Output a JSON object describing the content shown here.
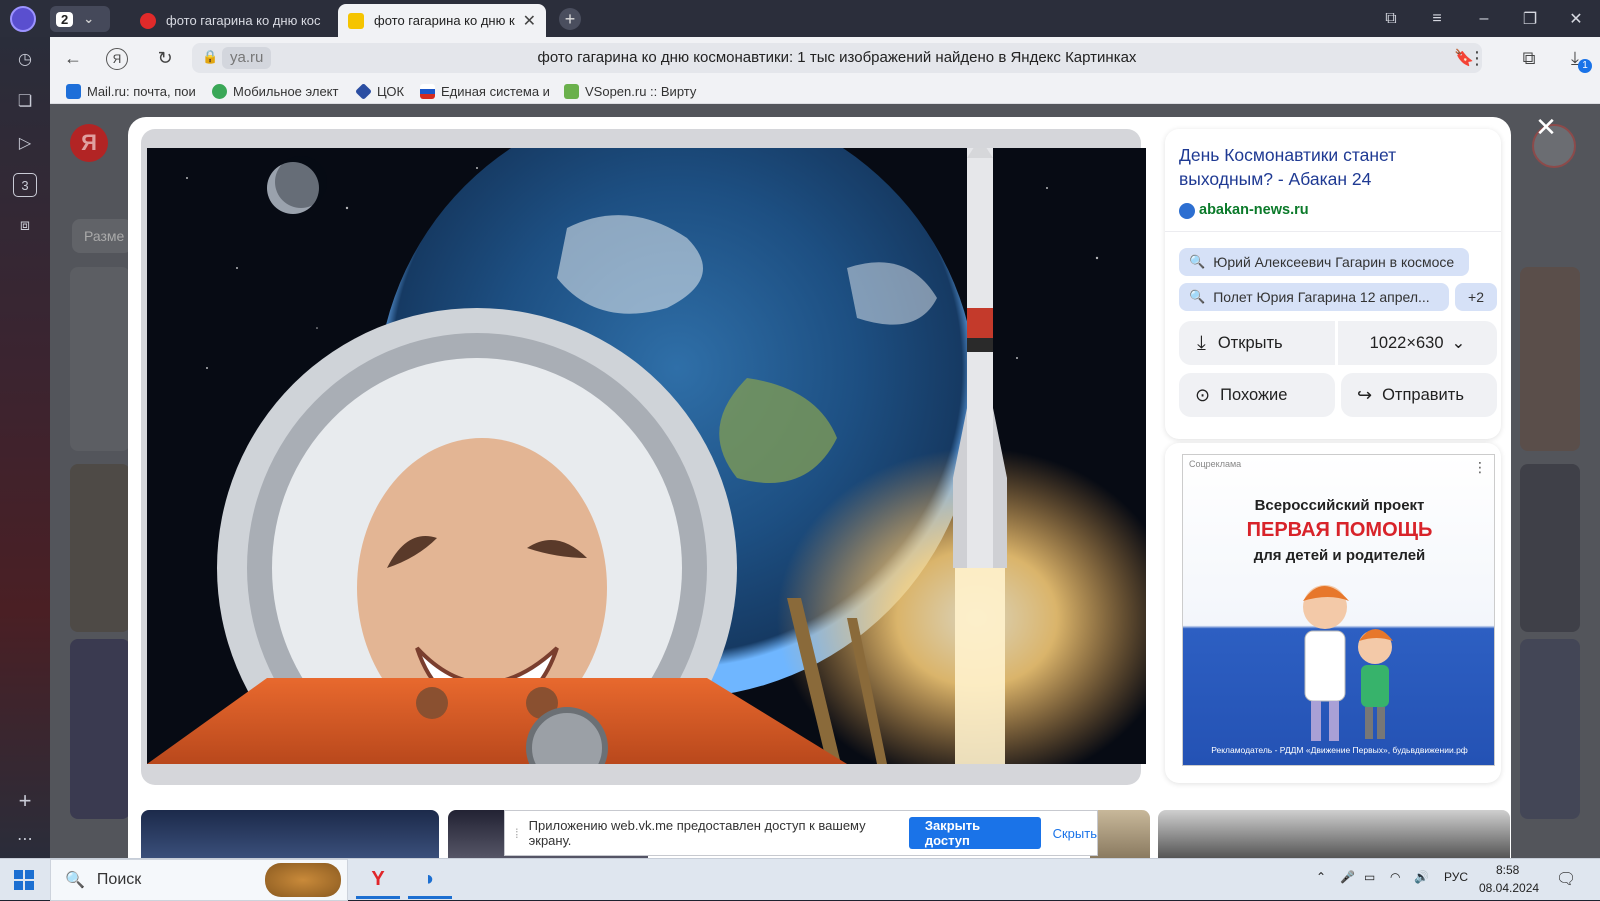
{
  "browser": {
    "tab_count": "2",
    "tabs": [
      {
        "title": "фото гагарина ко дню кос",
        "active": false
      },
      {
        "title": "фото гагарина ко дню к",
        "active": true
      }
    ],
    "url": "ya.ru",
    "page_title": "фото гагарина ко дню космонавтики: 1 тыс изображений найдено в Яндекс Картинках",
    "download_badge": "1"
  },
  "bookmarks": [
    {
      "label": "Mail.ru: почта, пои",
      "color": "#1e6fd9"
    },
    {
      "label": "Мобильное элект",
      "color": "#3aa757"
    },
    {
      "label": "ЦОК",
      "color": "#2b4ea2"
    },
    {
      "label": "Единая система и",
      "color": "#d52b1e"
    },
    {
      "label": "VSopen.ru :: Вирту",
      "color": "#6ab04c"
    }
  ],
  "sidebar": {
    "badge_3": "3"
  },
  "page": {
    "logo": "Я",
    "filter_label": "Разме"
  },
  "viewer": {
    "source_title": "День Космонавтики станет выходным? - Абакан 24",
    "source_domain": "abakan-news.ru",
    "tags": [
      "Юрий Алексеевич Гагарин в космосе",
      "Полет Юрия Гагарина 12 апрел..."
    ],
    "tags_more": "+2",
    "open_label": "Открыть",
    "size_label": "1022×630",
    "similar_label": "Похожие",
    "share_label": "Отправить",
    "ad": {
      "tag": "Соцреклама",
      "line1": "Всероссийский проект",
      "line2": "ПЕРВАЯ ПОМОЩЬ",
      "line3": "для детей и родителей",
      "footer": "Рекламодатель - РДДМ «Движение Первых», будьвдвижении.рф"
    }
  },
  "share_notice": {
    "text": "Приложению web.vk.me предоставлен доступ к вашему экрану.",
    "close_label": "Закрыть доступ",
    "hide_label": "Скрыть"
  },
  "taskbar": {
    "search_label": "Поиск",
    "lang": "РУС",
    "time": "8:58",
    "date": "08.04.2024"
  },
  "colors": {
    "accent": "#1a73e8",
    "link": "#1f3a93",
    "domain": "#0b7a2a"
  }
}
